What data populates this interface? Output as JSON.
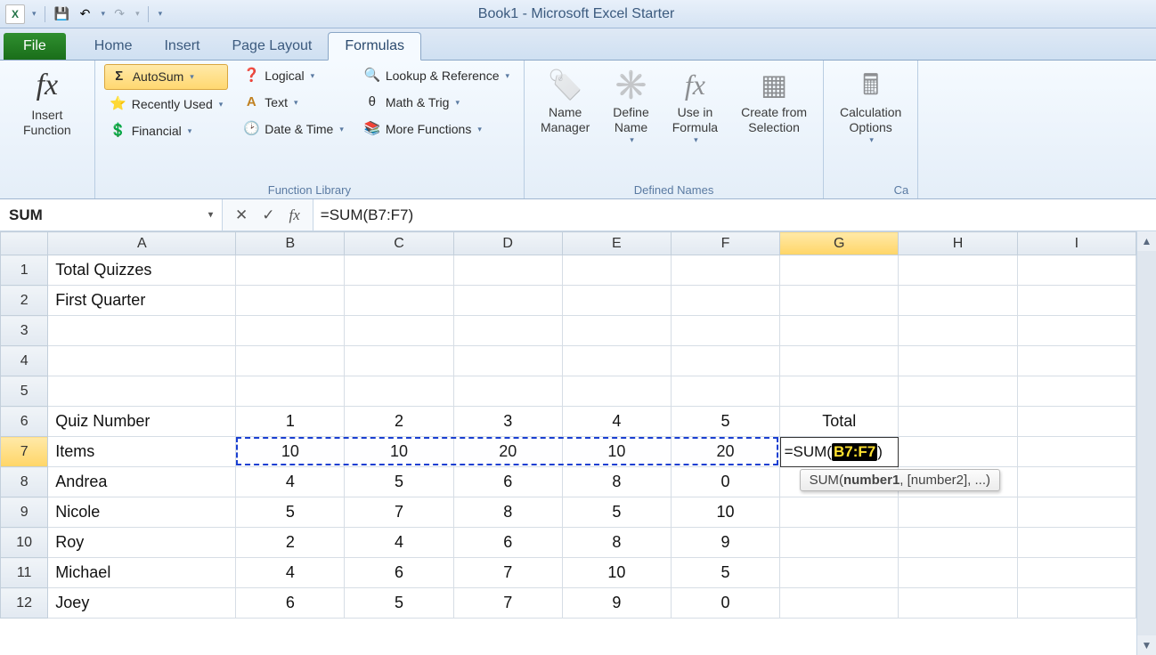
{
  "app_title": "Book1  -  Microsoft Excel Starter",
  "qat": {
    "undo": "↶",
    "redo": "↷"
  },
  "tabs": {
    "file": "File",
    "items": [
      "Home",
      "Insert",
      "Page Layout",
      "Formulas"
    ],
    "active_index": 3
  },
  "ribbon": {
    "insert_function": {
      "label_line1": "Insert",
      "label_line2": "Function"
    },
    "library": {
      "autosum": "AutoSum",
      "recently_used": "Recently Used",
      "financial": "Financial",
      "logical": "Logical",
      "text": "Text",
      "date_time": "Date & Time",
      "lookup": "Lookup & Reference",
      "math_trig": "Math & Trig",
      "more": "More Functions",
      "group_label": "Function Library"
    },
    "names": {
      "name_manager": {
        "l1": "Name",
        "l2": "Manager"
      },
      "define_name": {
        "l1": "Define",
        "l2": "Name"
      },
      "use_in_formula": {
        "l1": "Use in",
        "l2": "Formula"
      },
      "create_from": {
        "l1": "Create from",
        "l2": "Selection"
      },
      "group_label": "Defined Names"
    },
    "calc": {
      "l1": "Calculation",
      "l2": "Options",
      "group_frag": "Ca"
    }
  },
  "formula_bar": {
    "name_box": "SUM",
    "formula_text": "=SUM(B7:F7)"
  },
  "columns": [
    "A",
    "B",
    "C",
    "D",
    "E",
    "F",
    "G",
    "H",
    "I"
  ],
  "selected_col": "G",
  "selected_row": 7,
  "sheet": {
    "rows": [
      {
        "n": 1,
        "cells": [
          "Total Quizzes",
          "",
          "",
          "",
          "",
          "",
          "",
          "",
          ""
        ]
      },
      {
        "n": 2,
        "cells": [
          "First Quarter",
          "",
          "",
          "",
          "",
          "",
          "",
          "",
          ""
        ]
      },
      {
        "n": 3,
        "cells": [
          "",
          "",
          "",
          "",
          "",
          "",
          "",
          "",
          ""
        ]
      },
      {
        "n": 4,
        "cells": [
          "",
          "",
          "",
          "",
          "",
          "",
          "",
          "",
          ""
        ]
      },
      {
        "n": 5,
        "cells": [
          "",
          "",
          "",
          "",
          "",
          "",
          "",
          "",
          ""
        ]
      },
      {
        "n": 6,
        "cells": [
          "Quiz Number",
          "1",
          "2",
          "3",
          "4",
          "5",
          "Total",
          "",
          ""
        ]
      },
      {
        "n": 7,
        "cells": [
          "Items",
          "10",
          "10",
          "20",
          "10",
          "20",
          "",
          "",
          ""
        ]
      },
      {
        "n": 8,
        "cells": [
          "Andrea",
          "4",
          "5",
          "6",
          "8",
          "0",
          "",
          "",
          ""
        ]
      },
      {
        "n": 9,
        "cells": [
          "Nicole",
          "5",
          "7",
          "8",
          "5",
          "10",
          "",
          "",
          ""
        ]
      },
      {
        "n": 10,
        "cells": [
          "Roy",
          "2",
          "4",
          "6",
          "8",
          "9",
          "",
          "",
          ""
        ]
      },
      {
        "n": 11,
        "cells": [
          "Michael",
          "4",
          "6",
          "7",
          "10",
          "5",
          "",
          "",
          ""
        ]
      },
      {
        "n": 12,
        "cells": [
          "Joey",
          "6",
          "5",
          "7",
          "9",
          "0",
          "",
          "",
          ""
        ]
      }
    ]
  },
  "active_formula": {
    "prefix": "=SUM(",
    "range": "B7:F7",
    "suffix": ")"
  },
  "tooltip": {
    "fn": "SUM",
    "sig_bold": "number1",
    "sig_rest": ", [number2], ...)"
  }
}
